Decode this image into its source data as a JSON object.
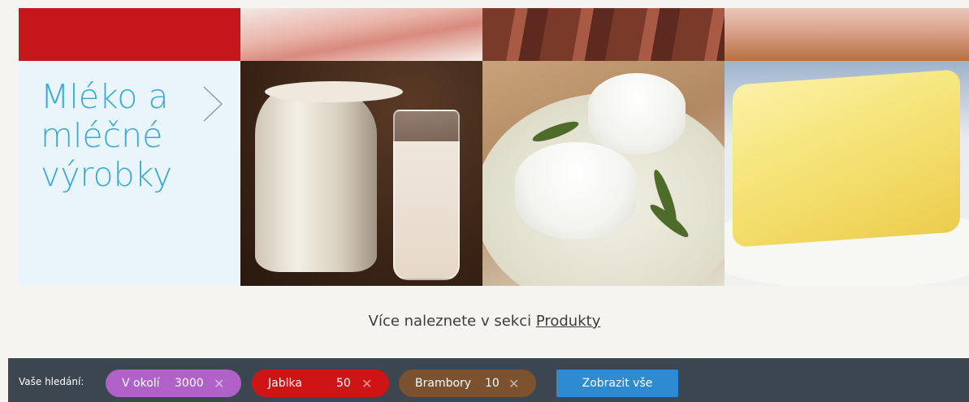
{
  "category": {
    "title_line1": "Mléko a",
    "title_line2": "mléčné",
    "title_line3": "výrobky"
  },
  "more": {
    "prefix": "Více naleznete v sekci",
    "link": "Produkty"
  },
  "search_bar": {
    "label": "Vaše hledání:",
    "chips": [
      {
        "label": "V okolí",
        "value": "3000",
        "color": "#b061c8"
      },
      {
        "label": "Jablka",
        "value": "50",
        "color": "#cf1416"
      },
      {
        "label": "Brambory",
        "value": "10",
        "color": "#7b5130"
      }
    ],
    "show_all": "Zobrazit vše"
  },
  "colors": {
    "accent_blue": "#3aabd8",
    "bar_bg": "#3c4651",
    "button_blue": "#2e8bd2"
  }
}
